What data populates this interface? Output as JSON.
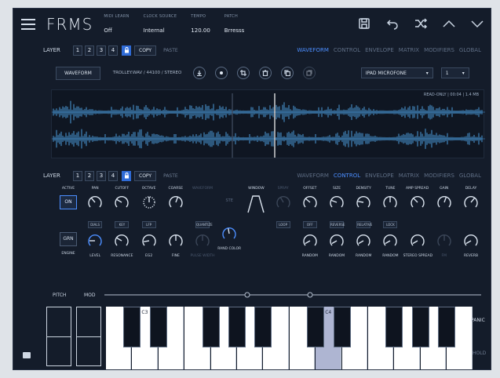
{
  "app": {
    "name": "FRMS"
  },
  "topbar": {
    "fields": [
      {
        "caption": "MIDI LEARN",
        "value": "Off"
      },
      {
        "caption": "CLOCK SOURCE",
        "value": "Internal"
      },
      {
        "caption": "TEMPO",
        "value": "120.00"
      },
      {
        "caption": "PATCH",
        "value": "Brresss"
      }
    ]
  },
  "layer1": {
    "label": "LAYER",
    "numbers": [
      "1",
      "2",
      "3",
      "4"
    ],
    "copy": "COPY",
    "paste": "PASTE",
    "tabs": [
      "WAVEFORM",
      "CONTROL",
      "ENVELOPE",
      "MATRIX",
      "MODIFIERS",
      "GLOBAL"
    ],
    "active_tab": "WAVEFORM"
  },
  "waveform": {
    "button": "WAVEFORM",
    "file": "TROLLEY.WAV / 44100 / STEREO",
    "input_select": "IPAD MICROFONE",
    "channel_select": "1",
    "info": "READ-ONLY | 00:04 | 1.4 MB"
  },
  "layer2": {
    "label": "LAYER",
    "numbers": [
      "1",
      "2",
      "3",
      "4"
    ],
    "copy": "COPY",
    "paste": "PASTE",
    "tabs": [
      "WAVEFORM",
      "CONTROL",
      "ENVELOPE",
      "MATRIX",
      "MODIFIERS",
      "GLOBAL"
    ],
    "active_tab": "CONTROL"
  },
  "control": {
    "row1_captions": [
      "ACTIVE",
      "PAN",
      "CUTOFF",
      "OCTAVE",
      "COARSE",
      "WAVEFORM",
      "",
      "WINDOW",
      "SPRAY",
      "OFFSET",
      "SIZE",
      "DENSITY",
      "TUNE",
      "AMP SPREAD",
      "GAIN",
      "DELAY"
    ],
    "active_button": "ON",
    "ste_label": "STE",
    "small_buttons": [
      "DIALS",
      "KEY",
      "LFP",
      "QUANTIZE",
      "LOOP",
      "OFF",
      "REVERSE",
      "RELATIVE",
      "LOCK"
    ],
    "engine_button": "GRN",
    "row2_captions": [
      "ENGINE",
      "LEVEL",
      "RESONANCE",
      "EG2",
      "FINE",
      "PULSE WIDTH",
      "RAND COLOR",
      "",
      "",
      "RANDOM",
      "RANDOM",
      "RANDOM",
      "RANDOM",
      "STEREO SPREAD",
      "FM",
      "REVERB"
    ]
  },
  "keyboard": {
    "pitch_label": "PITCH",
    "mod_label": "MOD",
    "octave_labels": [
      "C3",
      "C4"
    ],
    "panic": "PANIC",
    "hold": "HOLD"
  },
  "colors": {
    "accent": "#4c8eff",
    "background": "#141c2a",
    "wave": "#4b9ad8"
  }
}
